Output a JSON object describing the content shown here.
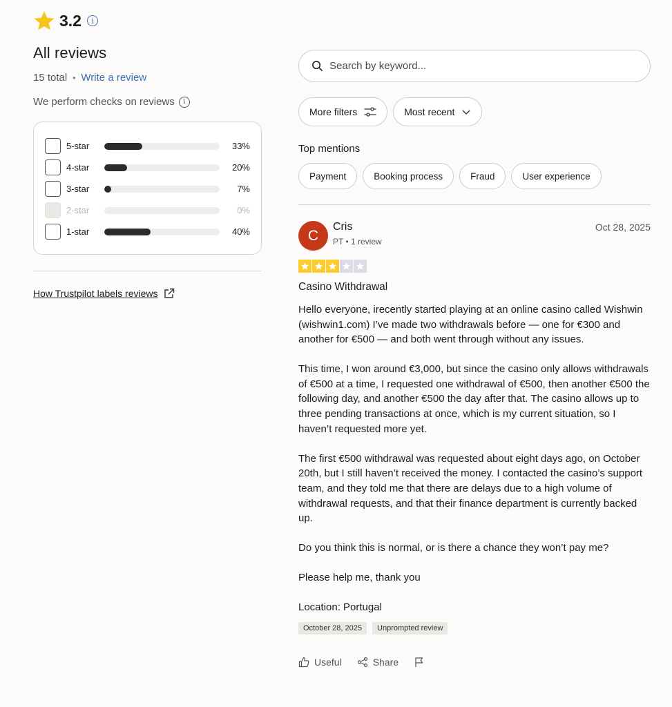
{
  "summary": {
    "rating": "3.2",
    "heading": "All reviews",
    "total": "15 total",
    "write_review": "Write a review",
    "checks_text": "We perform checks on reviews"
  },
  "distribution": [
    {
      "label": "5-star",
      "percent_text": "33%",
      "fraction": 0.33,
      "disabled": false
    },
    {
      "label": "4-star",
      "percent_text": "20%",
      "fraction": 0.2,
      "disabled": false
    },
    {
      "label": "3-star",
      "percent_text": "7%",
      "fraction": 0.07,
      "disabled": false
    },
    {
      "label": "2-star",
      "percent_text": "0%",
      "fraction": 0.0,
      "disabled": true
    },
    {
      "label": "1-star",
      "percent_text": "40%",
      "fraction": 0.4,
      "disabled": false
    }
  ],
  "labels_link": "How Trustpilot labels reviews",
  "search": {
    "placeholder": "Search by keyword..."
  },
  "filters": {
    "more_filters": "More filters",
    "sort": "Most recent"
  },
  "top_mentions": {
    "heading": "Top mentions",
    "items": [
      "Payment",
      "Booking process",
      "Fraud",
      "User experience"
    ]
  },
  "review": {
    "avatar_letter": "C",
    "name": "Cris",
    "meta": "PT • 1 review",
    "date": "Oct 28, 2025",
    "stars": 3,
    "title": "Casino Withdrawal",
    "paragraphs": [
      "Hello everyone, irecently started playing at an online casino called Wishwin (wishwin1.com) I’ve made two withdrawals before — one for €300 and another for €500 — and both went through without any issues.",
      "This time, I won around €3,000, but since the casino only allows withdrawals of €500 at a time, I requested one withdrawal of €500, then another €500 the following day, and another €500 the day after that. The casino allows up to three pending transactions at once, which is my current situation, so I haven’t requested more yet.",
      "The first €500 withdrawal was requested about eight days ago, on October 20th, but I still haven’t received the money. I contacted the casino’s support team, and they told me that there are delays due to a high volume of withdrawal requests, and that their finance department is currently backed up.",
      "Do you think this is normal, or is there a chance they won’t pay me?",
      "Please help me, thank you",
      "Location: Portugal"
    ],
    "tags": [
      "October 28, 2025",
      "Unprompted review"
    ],
    "actions": {
      "useful": "Useful",
      "share": "Share"
    }
  },
  "colors": {
    "star_yellow": "#fccc2e",
    "star_empty": "#dcdce6",
    "avatar": "#c5391a",
    "link_blue": "#3b6fb6",
    "bar_fill": "#2a2b2a"
  }
}
